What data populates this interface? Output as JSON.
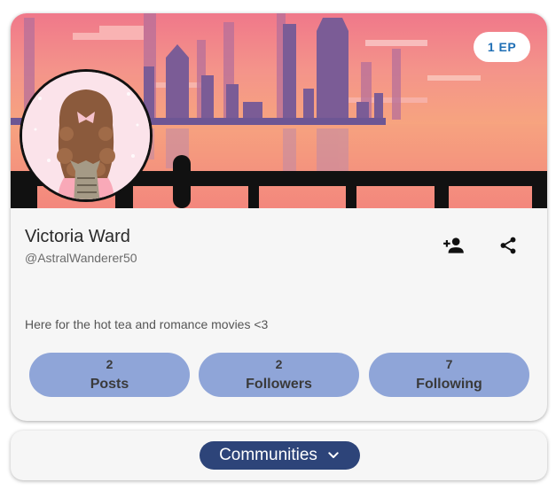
{
  "profile": {
    "ep_badge": "1 EP",
    "display_name": "Victoria Ward",
    "handle": "@AstralWanderer50",
    "bio": "Here for the hot tea and romance movies <3",
    "icons": {
      "follow": "add-person-icon",
      "share": "share-icon"
    },
    "stats": [
      {
        "count": "2",
        "label": "Posts"
      },
      {
        "count": "2",
        "label": "Followers"
      },
      {
        "count": "7",
        "label": "Following"
      }
    ]
  },
  "communities": {
    "label": "Communities",
    "icon": "chevron-down-icon"
  },
  "colors": {
    "card_bg": "#f6f6f6",
    "stat_pill": "#8fa5d8",
    "communities_pill": "#2d4479",
    "badge_text": "#1f6fb5"
  }
}
